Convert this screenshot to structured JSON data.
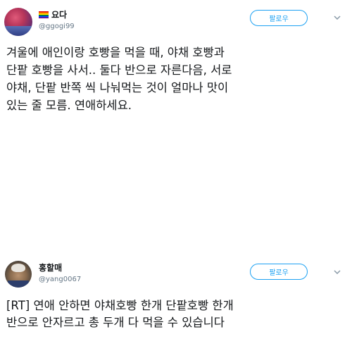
{
  "tweets": [
    {
      "display_name": "요다",
      "handle": "@ggogi99",
      "follow_label": "팔로우",
      "lines": [
        "겨울에 애인이랑 호빵을 먹을 때, 야채 호빵과",
        "단팥 호빵을 사서.. 둘다 반으로 자른다음, 서로",
        "야채, 단팥 반쪽 씩 나눠먹는 것이 얼마나 맛이",
        "있는 줄 모름. 연애하세요."
      ]
    },
    {
      "display_name": "홍할매",
      "handle": "@yang0067",
      "follow_label": "팔로우",
      "lines": [
        "[RT] 연애 안하면 야채호빵 한개 단팥호빵 한개",
        "반으로 안자르고 총 두개 다 먹을 수 있습니다"
      ]
    }
  ],
  "colors": {
    "accent": "#1da1f2",
    "handle": "#657786",
    "text": "#14171a"
  },
  "icons": [
    "rainbow-flag-icon",
    "chevron-down-icon"
  ]
}
